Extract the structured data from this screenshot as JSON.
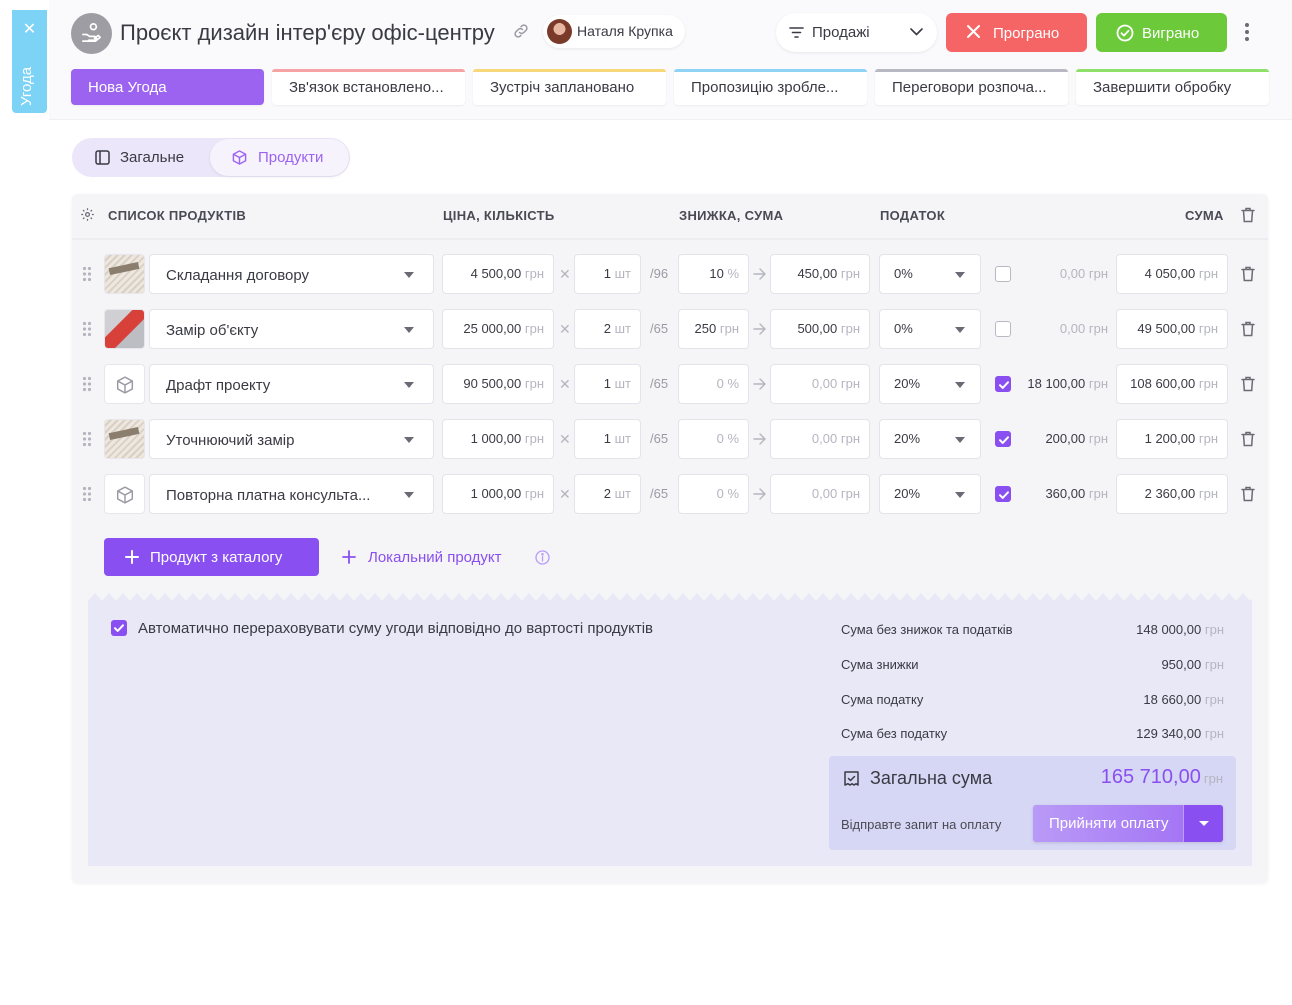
{
  "side_tab": {
    "label": "Угода"
  },
  "header": {
    "title": "Проєкт дизайн інтер'єру офіс-центру",
    "responsible": "Наталя Крупка",
    "pipeline": "Продажі",
    "lost_label": "Програно",
    "won_label": "Виграно",
    "colors": {
      "lost": "#f56565",
      "won": "#6cc93a",
      "accent": "#9c63f0"
    }
  },
  "stages": [
    {
      "label": "Нова Угода",
      "color": "#9c63f0",
      "active": true
    },
    {
      "label": "Зв'язок встановлено...",
      "color": "#f5a3a3"
    },
    {
      "label": "Зустріч заплановано",
      "color": "#f6d77a"
    },
    {
      "label": "Пропозицію зробле...",
      "color": "#8fd3f4"
    },
    {
      "label": "Переговори розпоча...",
      "color": "#b8b8c2"
    },
    {
      "label": "Завершити обробку",
      "color": "#8ee06b"
    }
  ],
  "tabs": {
    "general": "Загальне",
    "products": "Продукти"
  },
  "table": {
    "headers": {
      "products": "СПИСОК ПРОДУКТІВ",
      "price_qty": "ЦІНА, КІЛЬКІСТЬ",
      "discount": "ЗНИЖКА, СУМА",
      "tax": "ПОДАТОК",
      "total": "СУМА"
    },
    "currency": "грн",
    "rows": [
      {
        "image": "document",
        "name": "Складання договору",
        "price": "4 500,00",
        "qty": "1",
        "qty_unit": "шт",
        "stock": "/96",
        "discount": "10",
        "discount_unit": "%",
        "discount_sum": "450,00",
        "tax": "0%",
        "tax_checked": false,
        "tax_amount": "0,00",
        "total": "4 050,00"
      },
      {
        "image": "measure",
        "name": "Замір об'єкту",
        "price": "25 000,00",
        "qty": "2",
        "qty_unit": "шт",
        "stock": "/65",
        "discount": "250",
        "discount_unit": "грн",
        "discount_sum": "500,00",
        "tax": "0%",
        "tax_checked": false,
        "tax_amount": "0,00",
        "total": "49 500,00"
      },
      {
        "image": "box",
        "name": "Драфт проекту",
        "price": "90 500,00",
        "qty": "1",
        "qty_unit": "шт",
        "stock": "/65",
        "discount": "0",
        "discount_unit": "%",
        "discount_sum": "0,00",
        "tax": "20%",
        "tax_checked": true,
        "tax_amount": "18 100,00",
        "total": "108 600,00"
      },
      {
        "image": "document",
        "name": "Уточнюючий замір",
        "price": "1 000,00",
        "qty": "1",
        "qty_unit": "шт",
        "stock": "/65",
        "discount": "0",
        "discount_unit": "%",
        "discount_sum": "0,00",
        "tax": "20%",
        "tax_checked": true,
        "tax_amount": "200,00",
        "total": "1 200,00"
      },
      {
        "image": "box",
        "name": "Повторна платна консульта...",
        "price": "1 000,00",
        "qty": "2",
        "qty_unit": "шт",
        "stock": "/65",
        "discount": "0",
        "discount_unit": "%",
        "discount_sum": "0,00",
        "tax": "20%",
        "tax_checked": true,
        "tax_amount": "360,00",
        "total": "2 360,00"
      }
    ]
  },
  "actions": {
    "catalog_label": "Продукт з каталогу",
    "local_label": "Локальний продукт"
  },
  "summary": {
    "auto_recalc_label": "Автоматично перераховувати суму угоди відповідно до вартості продуктів",
    "auto_recalc_checked": true,
    "lines": [
      {
        "label": "Сума без знижок та податків",
        "value": "148 000,00"
      },
      {
        "label": "Сума знижки",
        "value": "950,00"
      },
      {
        "label": "Сума податку",
        "value": "18 660,00"
      },
      {
        "label": "Сума без податку",
        "value": "129 340,00"
      }
    ],
    "total_label": "Загальна сума",
    "total_value": "165 710,00",
    "currency": "грн",
    "payment_hint": "Відправте запит на оплату",
    "payment_button": "Прийняти оплату"
  }
}
